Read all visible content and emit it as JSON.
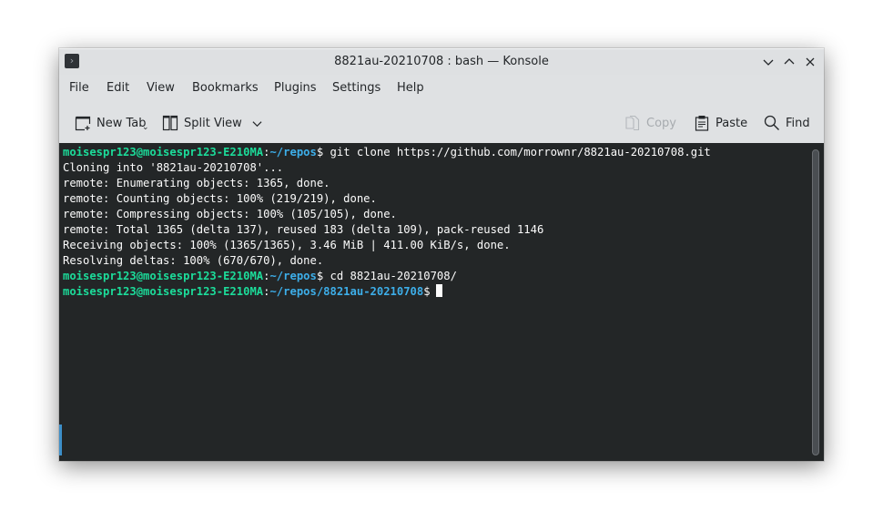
{
  "window": {
    "title": "8821au-20210708 : bash — Konsole",
    "app_icon": "terminal-prompt-icon",
    "controls": [
      "minimize",
      "maximize",
      "close"
    ]
  },
  "menubar": {
    "items": [
      "File",
      "Edit",
      "View",
      "Bookmarks",
      "Plugins",
      "Settings",
      "Help"
    ]
  },
  "toolbar": {
    "new_tab": "New Tab",
    "split_view": "Split View",
    "copy": "Copy",
    "paste": "Paste",
    "find": "Find"
  },
  "terminal": {
    "prompt_user": "moisespr123@moisespr123-E210MA",
    "lines": [
      {
        "type": "prompt",
        "path": "~/repos",
        "command": " git clone https://github.com/morrownr/8821au-20210708.git"
      },
      {
        "type": "output",
        "text": "Cloning into '8821au-20210708'..."
      },
      {
        "type": "output",
        "text": "remote: Enumerating objects: 1365, done."
      },
      {
        "type": "output",
        "text": "remote: Counting objects: 100% (219/219), done."
      },
      {
        "type": "output",
        "text": "remote: Compressing objects: 100% (105/105), done."
      },
      {
        "type": "output",
        "text": "remote: Total 1365 (delta 137), reused 183 (delta 109), pack-reused 1146"
      },
      {
        "type": "output",
        "text": "Receiving objects: 100% (1365/1365), 3.46 MiB | 411.00 KiB/s, done."
      },
      {
        "type": "output",
        "text": "Resolving deltas: 100% (670/670), done."
      },
      {
        "type": "prompt",
        "path": "~/repos",
        "command": " cd 8821au-20210708/"
      },
      {
        "type": "prompt",
        "path": "~/repos/8821au-20210708",
        "command": ""
      }
    ]
  },
  "colors": {
    "terminal_bg": "#232627",
    "prompt_user": "#1cdc9a",
    "prompt_path": "#3daee9",
    "text": "#fcfcfc"
  }
}
